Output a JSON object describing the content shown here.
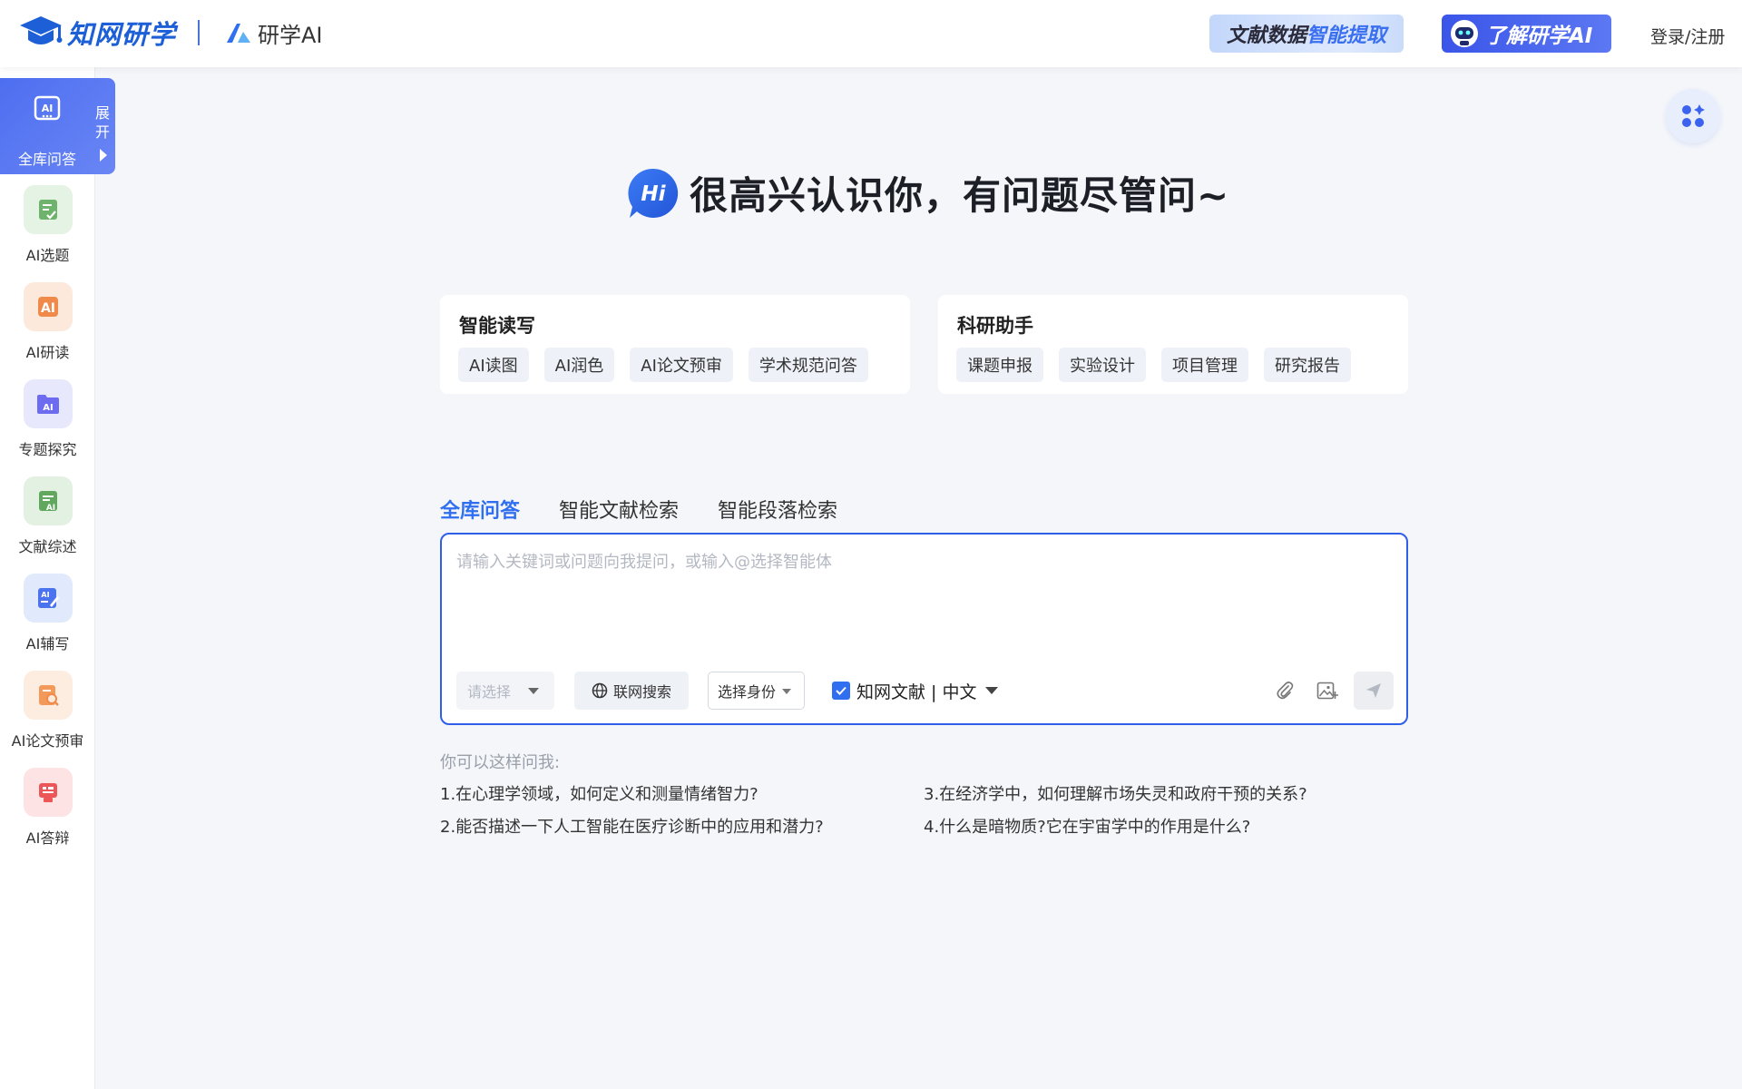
{
  "header": {
    "logo_text": "知网研学",
    "brand2_text": "研学AI",
    "banner1": {
      "part1": "文献数据",
      "part2": "智能提取"
    },
    "banner2_text": "了解研学AI",
    "login_label": "登录/注册"
  },
  "sidebar": {
    "active": {
      "label": "全库问答",
      "expand_label": "展开",
      "icon": "ai-chat-icon"
    },
    "items": [
      {
        "label": "AI选题",
        "icon": "checklist-icon",
        "color": "#6db36b",
        "bg": "#e4f3e3"
      },
      {
        "label": "AI研读",
        "icon": "ai-read-icon",
        "color": "#f08a4b",
        "bg": "#fde9dc"
      },
      {
        "label": "专题探究",
        "icon": "folder-ai-icon",
        "color": "#6d6cf0",
        "bg": "#e8e8fc"
      },
      {
        "label": "文献综述",
        "icon": "review-icon",
        "color": "#5fa85d",
        "bg": "#e3f1e2"
      },
      {
        "label": "AI辅写",
        "icon": "ai-write-icon",
        "color": "#4b73ee",
        "bg": "#e1e9fc"
      },
      {
        "label": "AI论文预审",
        "icon": "paper-search-icon",
        "color": "#f39a5a",
        "bg": "#fdece0"
      },
      {
        "label": "AI答辩",
        "icon": "defense-icon",
        "color": "#ec5656",
        "bg": "#fde3e3"
      }
    ]
  },
  "greeting": {
    "badge": "Hi",
    "text": "很高兴认识你，有问题尽管问~"
  },
  "cards": [
    {
      "title": "智能读写",
      "tags": [
        "AI读图",
        "AI润色",
        "AI论文预审",
        "学术规范问答"
      ]
    },
    {
      "title": "科研助手",
      "tags": [
        "课题申报",
        "实验设计",
        "项目管理",
        "研究报告"
      ]
    }
  ],
  "tabs": [
    {
      "label": "全库问答",
      "active": true
    },
    {
      "label": "智能文献检索",
      "active": false
    },
    {
      "label": "智能段落检索",
      "active": false
    }
  ],
  "input": {
    "placeholder": "请输入关键词或问题向我提问，或输入@选择智能体",
    "value": "",
    "select_placeholder": "请选择",
    "web_search_label": "联网搜索",
    "role_select_label": "选择身份",
    "source_label": "知网文献 | 中文",
    "source_checked": true
  },
  "suggestions": {
    "label": "你可以这样问我:",
    "items": [
      "1.在心理学领域，如何定义和测量情绪智力?",
      "2.能否描述一下人工智能在医疗诊断中的应用和潜力?",
      "3.在经济学中，如何理解市场失灵和政府干预的关系?",
      "4.什么是暗物质?它在宇宙学中的作用是什么?"
    ]
  },
  "colors": {
    "accent": "#2f6ff0",
    "border": "#2f5fe8",
    "active_sidebar": "#4d6ef0"
  }
}
